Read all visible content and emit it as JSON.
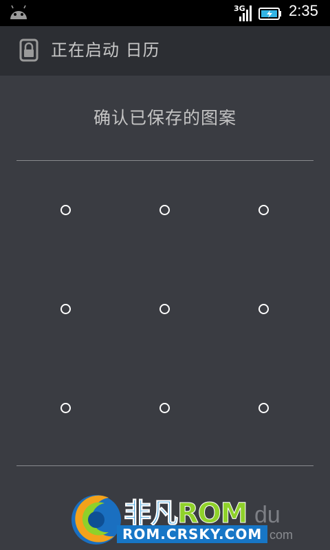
{
  "status_bar": {
    "time": "2:35",
    "network_label": "3G",
    "icons": [
      "android-icon",
      "signal-icon",
      "battery-charging-icon"
    ]
  },
  "header": {
    "title": "正在启动 日历",
    "icon": "lock-icon"
  },
  "prompt": "确认已保存的图案",
  "pattern": {
    "rows": 3,
    "cols": 3,
    "dot_color": "#ffffff"
  },
  "watermark": {
    "brand_prefix": "非凡",
    "brand_suffix": "ROM",
    "ghost_text": "du",
    "url": "ROM.CRSKY.COM",
    "com_text": "com"
  },
  "colors": {
    "background": "#3a3c42",
    "titlebar": "#2c2e33",
    "statusbar": "#000000"
  }
}
